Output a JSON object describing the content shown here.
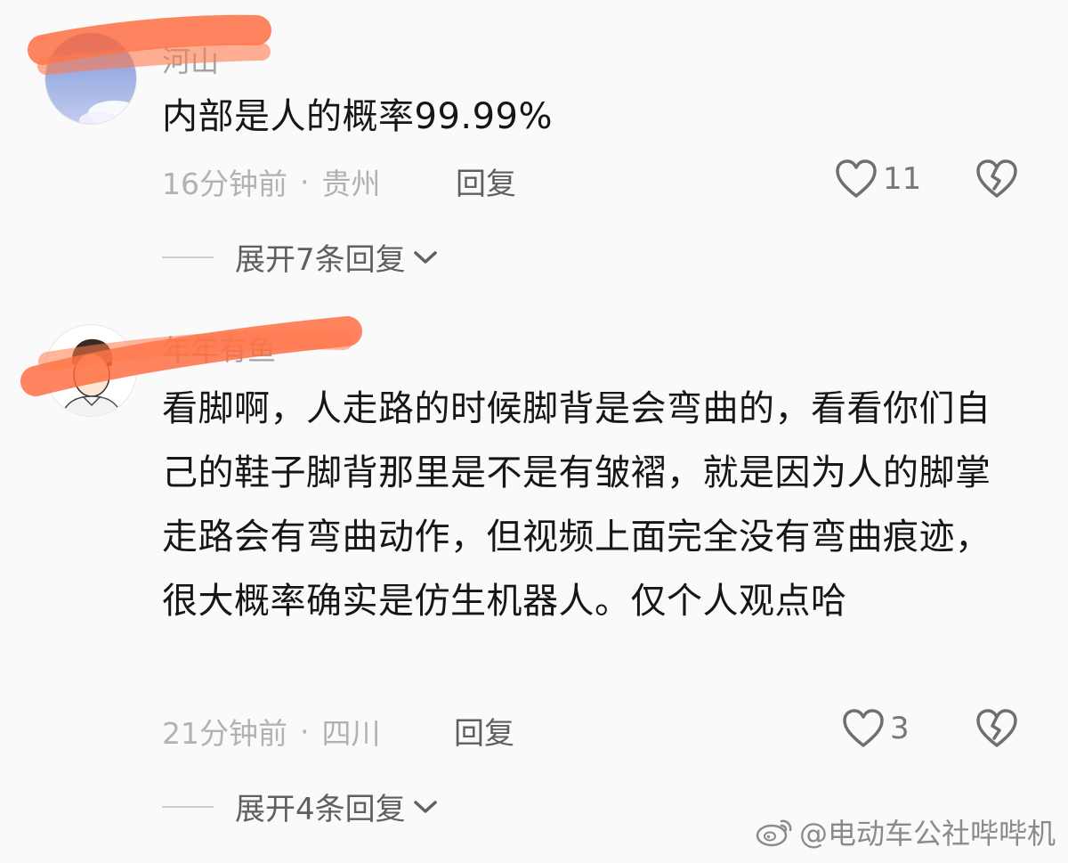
{
  "comments": [
    {
      "username": "河山",
      "text": "内部是人的概率99.99%",
      "time": "16分钟前",
      "separator": "·",
      "location": "贵州",
      "reply_label": "回复",
      "likes": "11",
      "expand_label": "展开7条回复"
    },
    {
      "username": "年年有鱼",
      "text": "看脚啊，人走路的时候脚背是会弯曲的，看看你们自己的鞋子脚背那里是不是有皱褶，就是因为人的脚掌走路会有弯曲动作，但视频上面完全没有弯曲痕迹，很大概率确实是仿生机器人。仅个人观点哈",
      "time": "21分钟前",
      "separator": "·",
      "location": "四川",
      "reply_label": "回复",
      "likes": "3",
      "expand_label": "展开4条回复"
    }
  ],
  "watermark": {
    "text": "@电动车公社哔哔机",
    "icon": "weibo-logo-icon"
  },
  "icons": {
    "like": "heart-outline-icon",
    "dislike": "broken-heart-icon",
    "expand": "chevron-down-icon"
  },
  "colors": {
    "redaction": "#ff6a3d",
    "background": "#fafafa"
  }
}
